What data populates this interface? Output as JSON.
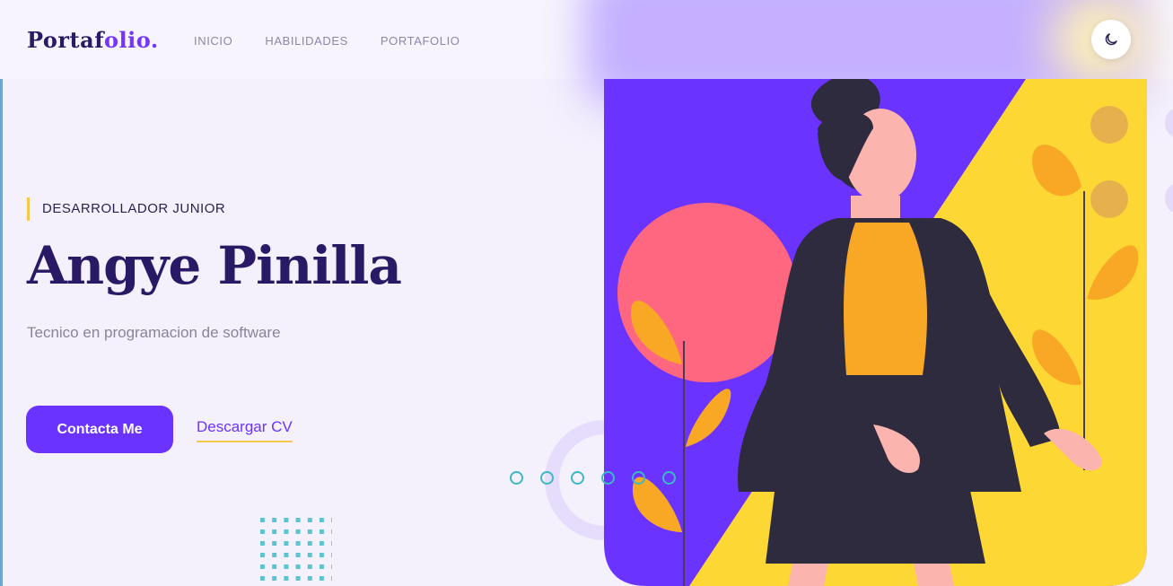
{
  "header": {
    "logo_main": "Portaf",
    "logo_accent": "olio.",
    "nav": [
      "INICIO",
      "HABILIDADES",
      "PORTAFOLIO"
    ],
    "theme_toggle_icon": "moon-icon"
  },
  "hero": {
    "role": "DESARROLLADOR JUNIOR",
    "name": "Angye Pinilla",
    "subtitle": "Tecnico en programacion de software",
    "contact_button": "Contacta Me",
    "cv_link": "Descargar CV"
  },
  "carousel": {
    "dot_count": 6
  },
  "colors": {
    "primary": "#6b33ff",
    "accent_yellow": "#fdd835",
    "title": "#2a1a66",
    "coral": "#ff6680",
    "teal": "#3cb8c6"
  }
}
